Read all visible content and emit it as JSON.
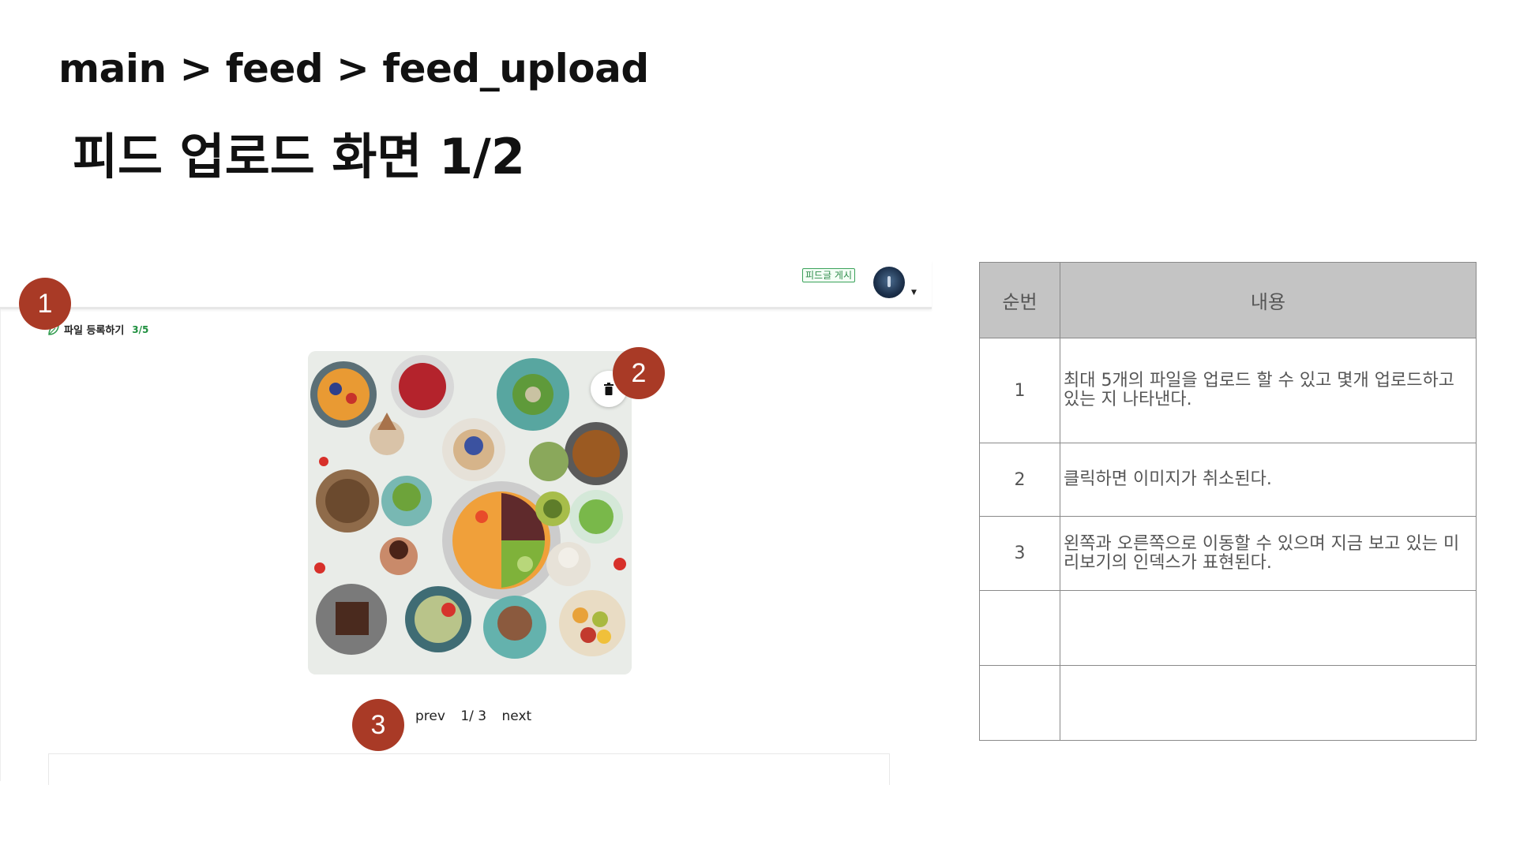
{
  "header": {
    "breadcrumb": "main > feed > feed_upload",
    "title": "피드 업로드 화면 1/2"
  },
  "app": {
    "post_button": "피드글 게시",
    "file_register": {
      "label": "파일 등록하기",
      "count": "3/5"
    },
    "pager": {
      "prev": "prev",
      "index": "1/ 3",
      "next": "next"
    },
    "icons": [
      "leaf-icon",
      "trash-icon",
      "avatar",
      "caret-down-icon"
    ]
  },
  "badges": [
    "1",
    "2",
    "3"
  ],
  "table": {
    "headers": [
      "순번",
      "내용"
    ],
    "rows": [
      {
        "no": "1",
        "content": "최대 5개의 파일을 업로드 할 수 있고 몇개 업로드하고 있는 지 나타낸다."
      },
      {
        "no": "2",
        "content": "클릭하면 이미지가 취소된다."
      },
      {
        "no": "3",
        "content": "왼쪽과 오른쪽으로 이동할 수 있으며 지금 보고 있는 미리보기의 인덱스가 표현된다."
      },
      {
        "no": "",
        "content": ""
      },
      {
        "no": "",
        "content": ""
      }
    ]
  },
  "colors": {
    "badge": "#a93a26",
    "accent_green": "#1e8f3e",
    "table_header": "#c4c4c4"
  }
}
